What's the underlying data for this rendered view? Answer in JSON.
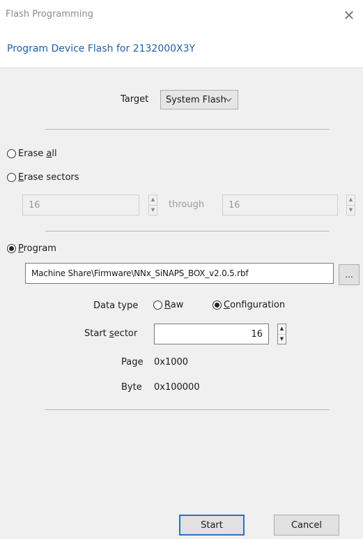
{
  "window": {
    "title": "Flash Programming",
    "close_glyph": "✕",
    "header": "Program Device Flash for 2132000X3Y"
  },
  "target": {
    "label": "Target",
    "selected": "System Flash",
    "chevron_icon": "chevron-down-icon"
  },
  "erase_all": {
    "accel": "E",
    "pre": "rase ",
    "under": "a",
    "post": "ll",
    "selected": false
  },
  "erase_sectors": {
    "under": "E",
    "rest": "rase sectors",
    "selected": false,
    "from_value": "16",
    "through_label": "through",
    "to_value": "16"
  },
  "program": {
    "under": "P",
    "rest": "rogram",
    "selected": true,
    "file_path": "Machine Share\\Firmware\\NNx_SiNAPS_BOX_v2.0.5.rbf",
    "browse_label": "..."
  },
  "data_type": {
    "label": "Data type",
    "raw_under": "R",
    "raw_rest": "aw",
    "raw_selected": false,
    "config_under": "C",
    "config_rest": "onfiguration",
    "config_selected": true
  },
  "start_sector": {
    "label_pre": "Start ",
    "label_under": "s",
    "label_post": "ector",
    "value": "16"
  },
  "page": {
    "label": "Page",
    "value": "0x1000"
  },
  "byte": {
    "label": "Byte",
    "value": "0x100000"
  },
  "buttons": {
    "start": "Start",
    "cancel": "Cancel"
  }
}
